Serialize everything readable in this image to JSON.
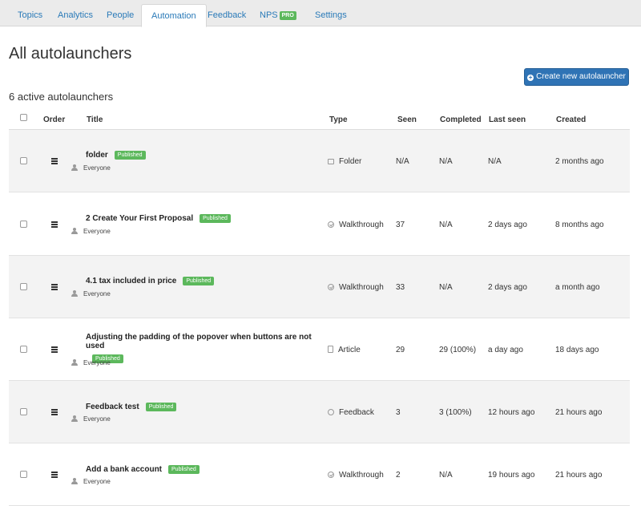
{
  "nav": {
    "tabs": [
      {
        "label": "Topics"
      },
      {
        "label": "Analytics"
      },
      {
        "label": "People"
      },
      {
        "label": "Automation"
      },
      {
        "label": "Feedback"
      },
      {
        "label": "NPS",
        "badge": "PRO"
      },
      {
        "label": "Settings"
      }
    ],
    "active": "Automation"
  },
  "page": {
    "title": "All autolaunchers",
    "create_button": "Create new autolauncher",
    "count_label": "6 active autolaunchers"
  },
  "table": {
    "headers": {
      "order": "Order",
      "title": "Title",
      "type": "Type",
      "seen": "Seen",
      "completed": "Completed",
      "last_seen": "Last seen",
      "created": "Created"
    },
    "rows": [
      {
        "title": "folder",
        "status": "Published",
        "audience": "Everyone",
        "type": "Folder",
        "type_icon": "folder-icon",
        "seen": "N/A",
        "completed": "N/A",
        "last_seen": "N/A",
        "created": "2 months ago"
      },
      {
        "title": "2 Create Your First Proposal",
        "status": "Published",
        "audience": "Everyone",
        "type": "Walkthrough",
        "type_icon": "walkthrough-icon",
        "seen": "37",
        "completed": "N/A",
        "last_seen": "2 days ago",
        "created": "8 months ago"
      },
      {
        "title": "4.1 tax included in price",
        "status": "Published",
        "audience": "Everyone",
        "type": "Walkthrough",
        "type_icon": "walkthrough-icon",
        "seen": "33",
        "completed": "N/A",
        "last_seen": "2 days ago",
        "created": "a month ago"
      },
      {
        "title": "Adjusting the padding of the popover when buttons are not used",
        "status": "Published",
        "audience": "Everyone",
        "type": "Article",
        "type_icon": "article-icon",
        "seen": "29",
        "completed": "29 (100%)",
        "last_seen": "a day ago",
        "created": "18 days ago"
      },
      {
        "title": "Feedback test",
        "status": "Published",
        "audience": "Everyone",
        "type": "Feedback",
        "type_icon": "feedback-icon",
        "seen": "3",
        "completed": "3 (100%)",
        "last_seen": "12 hours ago",
        "created": "21 hours ago"
      },
      {
        "title": "Add a bank account",
        "status": "Published",
        "audience": "Everyone",
        "type": "Walkthrough",
        "type_icon": "walkthrough-icon",
        "seen": "2",
        "completed": "N/A",
        "last_seen": "19 hours ago",
        "created": "21 hours ago"
      }
    ]
  },
  "colors": {
    "accent": "#2f73b5",
    "published": "#5cb85c",
    "link": "#2a7ab8"
  }
}
